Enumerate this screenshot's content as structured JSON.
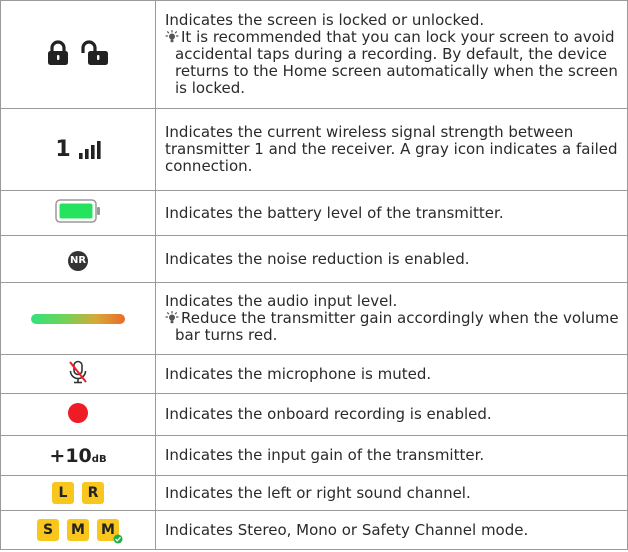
{
  "colors": {
    "border": "#9a9a9a",
    "battery_fill": "#25e35f",
    "record_red": "#ee1c24",
    "badge_yellow": "#f8c61d",
    "nr_badge": "#333333",
    "level_start": "#2fe27a",
    "level_end": "#ea6b2a"
  },
  "rows": [
    {
      "icon": "lock-unlock-icon",
      "description": "Indicates the screen is locked or unlocked.",
      "hint": "It is recommended that you can lock your screen to avoid accidental taps during a recording. By default, the device returns to the Home screen automatically when the screen is locked."
    },
    {
      "icon": "signal-strength-icon",
      "icon_text": "1",
      "description": "Indicates the current wireless signal strength between transmitter 1 and the receiver. A gray icon indicates a failed connection."
    },
    {
      "icon": "battery-icon",
      "description": "Indicates the battery level of the transmitter."
    },
    {
      "icon": "noise-reduction-icon",
      "icon_text": "NR",
      "description": "Indicates the noise reduction is enabled."
    },
    {
      "icon": "audio-level-bar-icon",
      "description": "Indicates the audio input level.",
      "hint": "Reduce the transmitter gain accordingly when the volume bar turns red."
    },
    {
      "icon": "mic-muted-icon",
      "description": "Indicates the microphone is muted."
    },
    {
      "icon": "recording-dot-icon",
      "description": "Indicates the onboard recording is enabled."
    },
    {
      "icon": "input-gain-icon",
      "icon_text": "+10",
      "icon_unit": "dB",
      "description": "Indicates the input gain of the transmitter."
    },
    {
      "icon": "sound-channel-icon",
      "badges": [
        "L",
        "R"
      ],
      "description": "Indicates the left or right sound channel."
    },
    {
      "icon": "channel-mode-icon",
      "badges": [
        "S",
        "M",
        "M"
      ],
      "description": "Indicates Stereo, Mono or Safety Channel mode."
    }
  ]
}
